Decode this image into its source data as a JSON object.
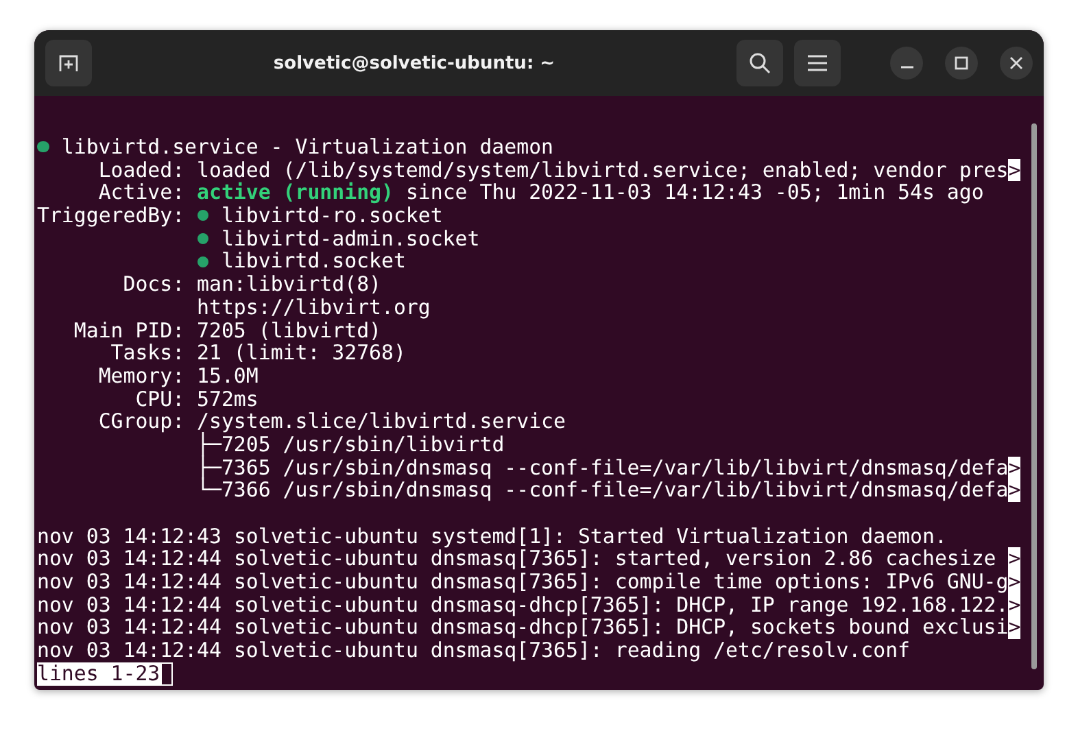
{
  "window": {
    "title": "solvetic@solvetic-ubuntu: ~"
  },
  "terminal": {
    "lines": [
      {
        "kind": "header",
        "dot": true,
        "text": "libvirtd.service - Virtualization daemon"
      },
      {
        "kind": "field",
        "label": "Loaded:",
        "text": "loaded (/lib/systemd/system/libvirtd.service; enabled; vendor pres",
        "more": ">"
      },
      {
        "kind": "field",
        "label": "Active:",
        "status": "active (running)",
        "text": "since Thu 2022-11-03 14:12:43 -05; 1min 54s ago"
      },
      {
        "kind": "field",
        "label": "TriggeredBy:",
        "dot": true,
        "text": "libvirtd-ro.socket"
      },
      {
        "kind": "field",
        "dot": true,
        "text": "libvirtd-admin.socket"
      },
      {
        "kind": "field",
        "dot": true,
        "text": "libvirtd.socket"
      },
      {
        "kind": "field",
        "label": "Docs:",
        "text": "man:libvirtd(8)"
      },
      {
        "kind": "field",
        "text": "https://libvirt.org"
      },
      {
        "kind": "field",
        "label": "Main PID:",
        "text": "7205 (libvirtd)"
      },
      {
        "kind": "field",
        "label": "Tasks:",
        "text": "21 (limit: 32768)"
      },
      {
        "kind": "field",
        "label": "Memory:",
        "text": "15.0M"
      },
      {
        "kind": "field",
        "label": "CPU:",
        "text": "572ms"
      },
      {
        "kind": "field",
        "label": "CGroup:",
        "text": "/system.slice/libvirtd.service"
      },
      {
        "kind": "field",
        "text": "├─7205 /usr/sbin/libvirtd"
      },
      {
        "kind": "field",
        "text": "├─7365 /usr/sbin/dnsmasq --conf-file=/var/lib/libvirt/dnsmasq/defa",
        "more": ">"
      },
      {
        "kind": "field",
        "text": "└─7366 /usr/sbin/dnsmasq --conf-file=/var/lib/libvirt/dnsmasq/defa",
        "more": ">"
      },
      {
        "kind": "blank"
      },
      {
        "kind": "log",
        "text": "nov 03 14:12:43 solvetic-ubuntu systemd[1]: Started Virtualization daemon."
      },
      {
        "kind": "log",
        "text": "nov 03 14:12:44 solvetic-ubuntu dnsmasq[7365]: started, version 2.86 cachesize ",
        "more": ">"
      },
      {
        "kind": "log",
        "text": "nov 03 14:12:44 solvetic-ubuntu dnsmasq[7365]: compile time options: IPv6 GNU-g",
        "more": ">"
      },
      {
        "kind": "log",
        "text": "nov 03 14:12:44 solvetic-ubuntu dnsmasq-dhcp[7365]: DHCP, IP range 192.168.122.",
        "more": ">"
      },
      {
        "kind": "log",
        "text": "nov 03 14:12:44 solvetic-ubuntu dnsmasq-dhcp[7365]: DHCP, sockets bound exclusi",
        "more": ">"
      },
      {
        "kind": "log",
        "text": "nov 03 14:12:44 solvetic-ubuntu dnsmasq[7365]: reading /etc/resolv.conf"
      },
      {
        "kind": "prompt",
        "text": "lines 1-23"
      }
    ]
  }
}
